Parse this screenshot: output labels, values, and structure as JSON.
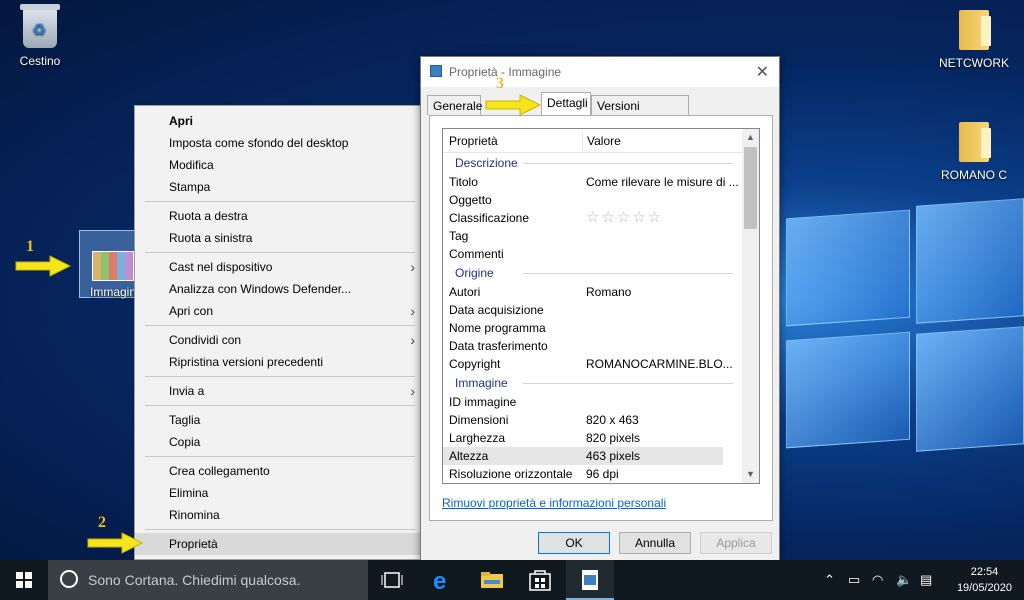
{
  "desktop": {
    "icons": [
      {
        "label": "Cestino"
      },
      {
        "label": "NETCWORK"
      },
      {
        "label": "ROMANO C"
      }
    ],
    "selected_icon_label": "Immagine"
  },
  "context_menu": {
    "groups": [
      [
        {
          "label": "Apri",
          "bold": true
        },
        {
          "label": "Imposta come sfondo del desktop"
        },
        {
          "label": "Modifica"
        },
        {
          "label": "Stampa"
        }
      ],
      [
        {
          "label": "Ruota a destra"
        },
        {
          "label": "Ruota a sinistra"
        }
      ],
      [
        {
          "label": "Cast nel dispositivo",
          "submenu": true
        },
        {
          "label": "Analizza con Windows Defender..."
        },
        {
          "label": "Apri con",
          "submenu": true
        }
      ],
      [
        {
          "label": "Condividi con",
          "submenu": true
        },
        {
          "label": "Ripristina versioni precedenti"
        }
      ],
      [
        {
          "label": "Invia a",
          "submenu": true
        }
      ],
      [
        {
          "label": "Taglia"
        },
        {
          "label": "Copia"
        }
      ],
      [
        {
          "label": "Crea collegamento"
        },
        {
          "label": "Elimina"
        },
        {
          "label": "Rinomina"
        }
      ],
      [
        {
          "label": "Proprietà",
          "highlighted": true
        }
      ]
    ]
  },
  "dialog": {
    "title": "Proprietà - Immagine",
    "tabs": [
      "Generale",
      "Dettagli",
      "Versioni precedenti"
    ],
    "active_tab": "Dettagli",
    "columns": [
      "Proprietà",
      "Valore"
    ],
    "sections": [
      {
        "name": "Descrizione",
        "rows": [
          {
            "k": "Titolo",
            "v": "Come rilevare le misure di ..."
          },
          {
            "k": "Oggetto",
            "v": ""
          },
          {
            "k": "Classificazione",
            "v": "☆☆☆☆☆",
            "stars": true
          },
          {
            "k": "Tag",
            "v": ""
          },
          {
            "k": "Commenti",
            "v": ""
          }
        ]
      },
      {
        "name": "Origine",
        "rows": [
          {
            "k": "Autori",
            "v": "Romano"
          },
          {
            "k": "Data acquisizione",
            "v": ""
          },
          {
            "k": "Nome programma",
            "v": ""
          },
          {
            "k": "Data trasferimento",
            "v": ""
          },
          {
            "k": "Copyright",
            "v": "ROMANOCARMINE.BLO..."
          }
        ]
      },
      {
        "name": "Immagine",
        "rows": [
          {
            "k": "ID immagine",
            "v": ""
          },
          {
            "k": "Dimensioni",
            "v": "820 x 463"
          },
          {
            "k": "Larghezza",
            "v": "820 pixels"
          },
          {
            "k": "Altezza",
            "v": "463 pixels",
            "selected": true
          },
          {
            "k": "Risoluzione orizzontale",
            "v": "96 dpi"
          }
        ]
      }
    ],
    "remove_link": "Rimuovi proprietà e informazioni personali",
    "buttons": {
      "ok": "OK",
      "cancel": "Annulla",
      "apply": "Applica"
    }
  },
  "annotations": [
    "1",
    "2",
    "3"
  ],
  "taskbar": {
    "search_placeholder": "Sono Cortana. Chiedimi qualcosa.",
    "time": "22:54",
    "date": "19/05/2020"
  },
  "colors": {
    "accent": "#0078d7",
    "annotation": "#e8c21d",
    "group_header": "#1e3287"
  }
}
